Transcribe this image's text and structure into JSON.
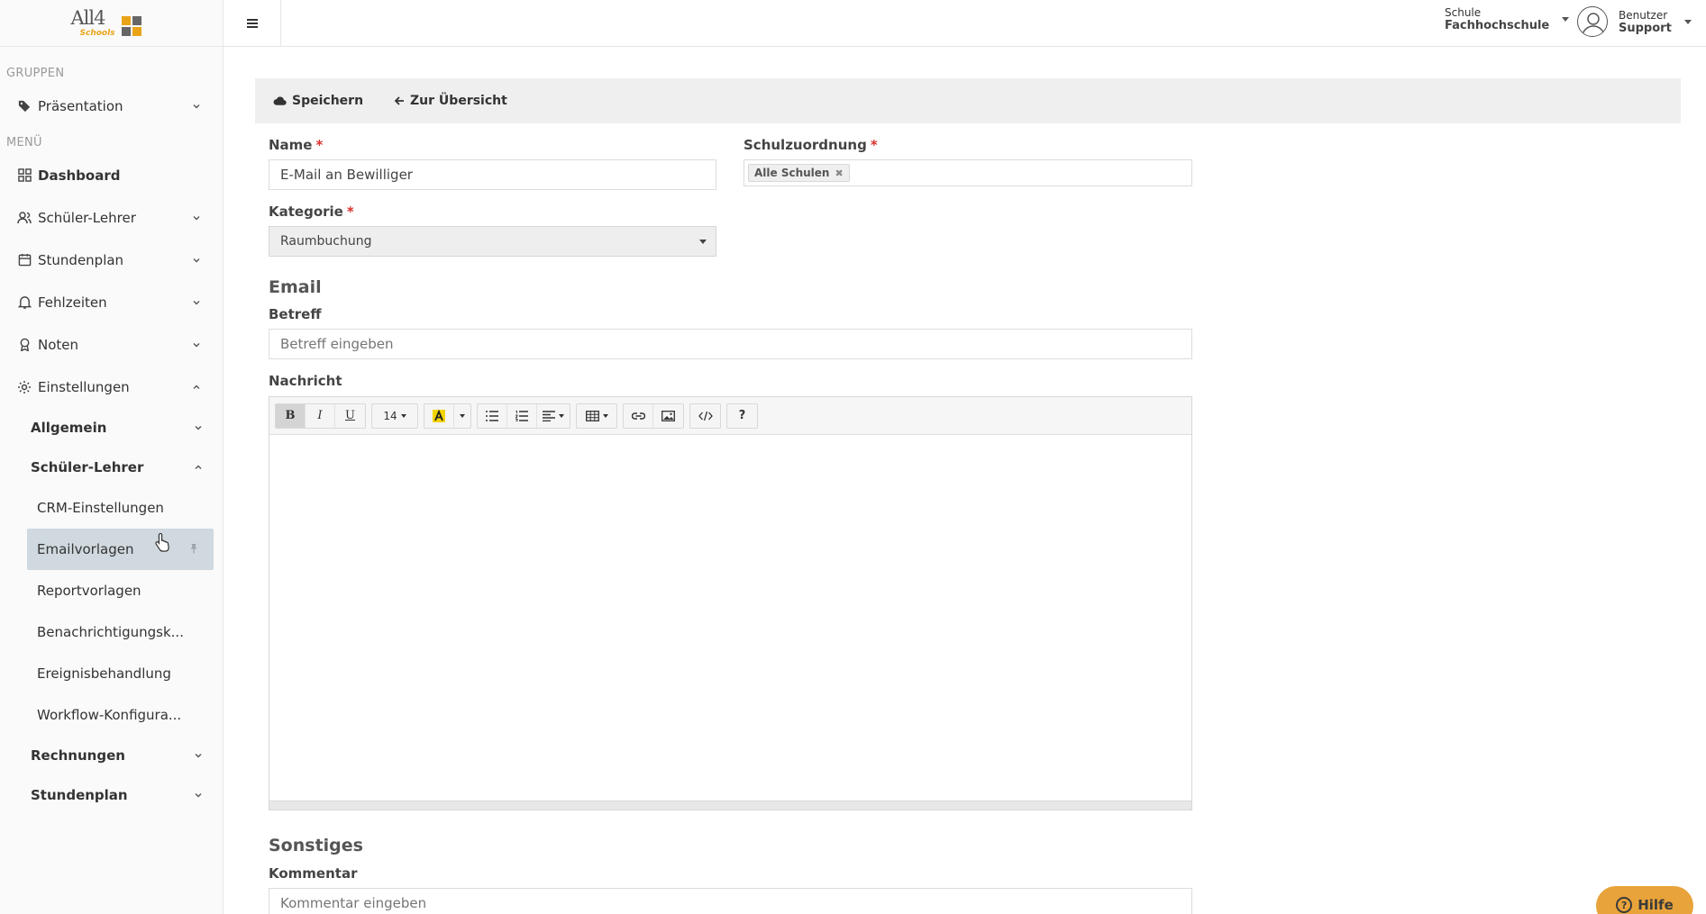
{
  "logo": {
    "main": "All4",
    "sub": "Schools"
  },
  "sidebar": {
    "groups_label": "GRUPPEN",
    "menu_label": "MENÜ",
    "groups": [
      {
        "label": "Präsentation",
        "icon": "tag-icon"
      }
    ],
    "menu": [
      {
        "label": "Dashboard",
        "icon": "grid-icon"
      },
      {
        "label": "Schüler-Lehrer",
        "icon": "users-icon"
      },
      {
        "label": "Stundenplan",
        "icon": "calendar-icon"
      },
      {
        "label": "Fehlzeiten",
        "icon": "bell-icon"
      },
      {
        "label": "Noten",
        "icon": "award-icon"
      },
      {
        "label": "Einstellungen",
        "icon": "gear-icon"
      }
    ],
    "settings_sub": [
      {
        "label": "Allgemein"
      },
      {
        "label": "Schüler-Lehrer"
      }
    ],
    "leaves": [
      {
        "label": "CRM-Einstellungen"
      },
      {
        "label": "Emailvorlagen"
      },
      {
        "label": "Reportvorlagen"
      },
      {
        "label": "Benachrichtigungsk..."
      },
      {
        "label": "Ereignisbehandlung"
      },
      {
        "label": "Workflow-Konfigura..."
      }
    ],
    "settings_sub_after": [
      {
        "label": "Rechnungen"
      },
      {
        "label": "Stundenplan"
      }
    ]
  },
  "topbar": {
    "school_caption": "Schule",
    "school_value": "Fachhochschule",
    "user_caption": "Benutzer",
    "user_value": "Support"
  },
  "toolbar": {
    "save_label": "Speichern",
    "overview_label": "Zur Übersicht"
  },
  "form": {
    "name_label": "Name",
    "name_value": "E-Mail an Bewilliger",
    "school_assign_label": "Schulzuordnung",
    "school_tag": "Alle Schulen",
    "category_label": "Kategorie",
    "category_value": "Raumbuchung",
    "required_mark": "*",
    "email_heading": "Email",
    "subject_label": "Betreff",
    "subject_placeholder": "Betreff eingeben",
    "message_label": "Nachricht",
    "misc_heading": "Sonstiges",
    "comment_label": "Kommentar",
    "comment_placeholder": "Kommentar eingeben"
  },
  "editor": {
    "bold": "B",
    "italic": "I",
    "underline": "U",
    "font_size": "14",
    "help": "?"
  },
  "help_button": {
    "label": "Hilfe",
    "icon_text": "?"
  },
  "colors": {
    "accent": "#e8a33a",
    "active_item": "#cfd9df",
    "required": "#d9302c",
    "highlight": "#f2d400"
  }
}
